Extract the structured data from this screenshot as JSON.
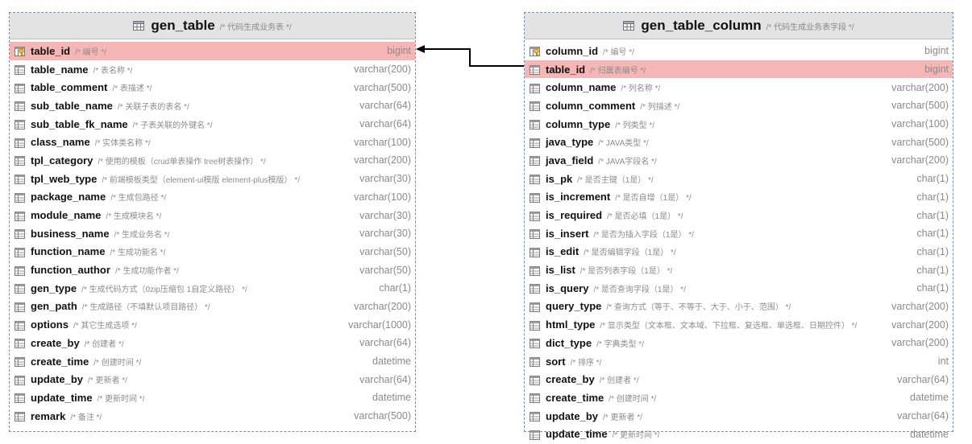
{
  "tables": [
    {
      "name": "gen_table",
      "comment": "/* 代码生成业务表 */",
      "columns": [
        {
          "name": "table_id",
          "comment": "/* 编号 */",
          "type": "bigint",
          "icon": "primary-key-icon",
          "highlight": true
        },
        {
          "name": "table_name",
          "comment": "/* 表名称 */",
          "type": "varchar(200)",
          "icon": "column-icon"
        },
        {
          "name": "table_comment",
          "comment": "/* 表描述 */",
          "type": "varchar(500)",
          "icon": "column-icon"
        },
        {
          "name": "sub_table_name",
          "comment": "/* 关联子表的表名 */",
          "type": "varchar(64)",
          "icon": "column-icon"
        },
        {
          "name": "sub_table_fk_name",
          "comment": "/* 子表关联的外键名 */",
          "type": "varchar(64)",
          "icon": "column-icon"
        },
        {
          "name": "class_name",
          "comment": "/* 实体类名称 */",
          "type": "varchar(100)",
          "icon": "column-icon"
        },
        {
          "name": "tpl_category",
          "comment": "/* 使用的模板（crud单表操作 tree树表操作） */",
          "type": "varchar(200)",
          "icon": "column-icon"
        },
        {
          "name": "tpl_web_type",
          "comment": "/* 前端模板类型（element-ui模版 element-plus模版） */",
          "type": "varchar(30)",
          "icon": "column-icon"
        },
        {
          "name": "package_name",
          "comment": "/* 生成包路径 */",
          "type": "varchar(100)",
          "icon": "column-icon"
        },
        {
          "name": "module_name",
          "comment": "/* 生成模块名 */",
          "type": "varchar(30)",
          "icon": "column-icon"
        },
        {
          "name": "business_name",
          "comment": "/* 生成业务名 */",
          "type": "varchar(30)",
          "icon": "column-icon"
        },
        {
          "name": "function_name",
          "comment": "/* 生成功能名 */",
          "type": "varchar(50)",
          "icon": "column-icon"
        },
        {
          "name": "function_author",
          "comment": "/* 生成功能作者 */",
          "type": "varchar(50)",
          "icon": "column-icon"
        },
        {
          "name": "gen_type",
          "comment": "/* 生成代码方式（0zip压缩包 1自定义路径） */",
          "type": "char(1)",
          "icon": "column-icon"
        },
        {
          "name": "gen_path",
          "comment": "/* 生成路径（不填默认项目路径） */",
          "type": "varchar(200)",
          "icon": "column-icon"
        },
        {
          "name": "options",
          "comment": "/* 其它生成选项 */",
          "type": "varchar(1000)",
          "icon": "column-icon"
        },
        {
          "name": "create_by",
          "comment": "/* 创建者 */",
          "type": "varchar(64)",
          "icon": "column-icon"
        },
        {
          "name": "create_time",
          "comment": "/* 创建时间 */",
          "type": "datetime",
          "icon": "column-icon"
        },
        {
          "name": "update_by",
          "comment": "/* 更新者 */",
          "type": "varchar(64)",
          "icon": "column-icon"
        },
        {
          "name": "update_time",
          "comment": "/* 更新时间 */",
          "type": "datetime",
          "icon": "column-icon"
        },
        {
          "name": "remark",
          "comment": "/* 备注 */",
          "type": "varchar(500)",
          "icon": "column-icon"
        }
      ]
    },
    {
      "name": "gen_table_column",
      "comment": "/* 代码生成业务表字段 */",
      "columns": [
        {
          "name": "column_id",
          "comment": "/* 编号 */",
          "type": "bigint",
          "icon": "primary-key-icon"
        },
        {
          "name": "table_id",
          "comment": "/* 归属表编号 */",
          "type": "bigint",
          "icon": "column-icon",
          "highlight": true
        },
        {
          "name": "column_name",
          "comment": "/* 列名称 */",
          "type": "varchar(200)",
          "icon": "column-icon"
        },
        {
          "name": "column_comment",
          "comment": "/* 列描述 */",
          "type": "varchar(500)",
          "icon": "column-icon"
        },
        {
          "name": "column_type",
          "comment": "/* 列类型 */",
          "type": "varchar(100)",
          "icon": "column-icon"
        },
        {
          "name": "java_type",
          "comment": "/* JAVA类型 */",
          "type": "varchar(500)",
          "icon": "column-icon"
        },
        {
          "name": "java_field",
          "comment": "/* JAVA字段名 */",
          "type": "varchar(200)",
          "icon": "column-icon"
        },
        {
          "name": "is_pk",
          "comment": "/* 是否主键（1是） */",
          "type": "char(1)",
          "icon": "column-icon"
        },
        {
          "name": "is_increment",
          "comment": "/* 是否自增（1是） */",
          "type": "char(1)",
          "icon": "column-icon"
        },
        {
          "name": "is_required",
          "comment": "/* 是否必填（1是） */",
          "type": "char(1)",
          "icon": "column-icon"
        },
        {
          "name": "is_insert",
          "comment": "/* 是否为插入字段（1是） */",
          "type": "char(1)",
          "icon": "column-icon"
        },
        {
          "name": "is_edit",
          "comment": "/* 是否编辑字段（1是） */",
          "type": "char(1)",
          "icon": "column-icon"
        },
        {
          "name": "is_list",
          "comment": "/* 是否列表字段（1是） */",
          "type": "char(1)",
          "icon": "column-icon"
        },
        {
          "name": "is_query",
          "comment": "/* 是否查询字段（1是） */",
          "type": "char(1)",
          "icon": "column-icon"
        },
        {
          "name": "query_type",
          "comment": "/* 查询方式（等于、不等于、大于、小于、范围） */",
          "type": "varchar(200)",
          "icon": "column-icon"
        },
        {
          "name": "html_type",
          "comment": "/* 显示类型（文本框、文本域、下拉框、复选框、单选框、日期控件） */",
          "type": "varchar(200)",
          "icon": "column-icon"
        },
        {
          "name": "dict_type",
          "comment": "/* 字典类型 */",
          "type": "varchar(200)",
          "icon": "column-icon"
        },
        {
          "name": "sort",
          "comment": "/* 排序 */",
          "type": "int",
          "icon": "column-icon"
        },
        {
          "name": "create_by",
          "comment": "/* 创建者 */",
          "type": "varchar(64)",
          "icon": "column-icon"
        },
        {
          "name": "create_time",
          "comment": "/* 创建时间 */",
          "type": "datetime",
          "icon": "column-icon"
        },
        {
          "name": "update_by",
          "comment": "/* 更新者 */",
          "type": "varchar(64)",
          "icon": "column-icon"
        },
        {
          "name": "update_time",
          "comment": "/* 更新时间 */",
          "type": "datetime",
          "icon": "column-icon"
        }
      ]
    }
  ],
  "relationship": {
    "from": "gen_table_column.table_id",
    "to": "gen_table.table_id"
  },
  "colors": {
    "highlight_row": "#f6b6b6",
    "header": "#e3e3e3",
    "border": "#6f8fc4",
    "key_icon": "#e08a00"
  }
}
